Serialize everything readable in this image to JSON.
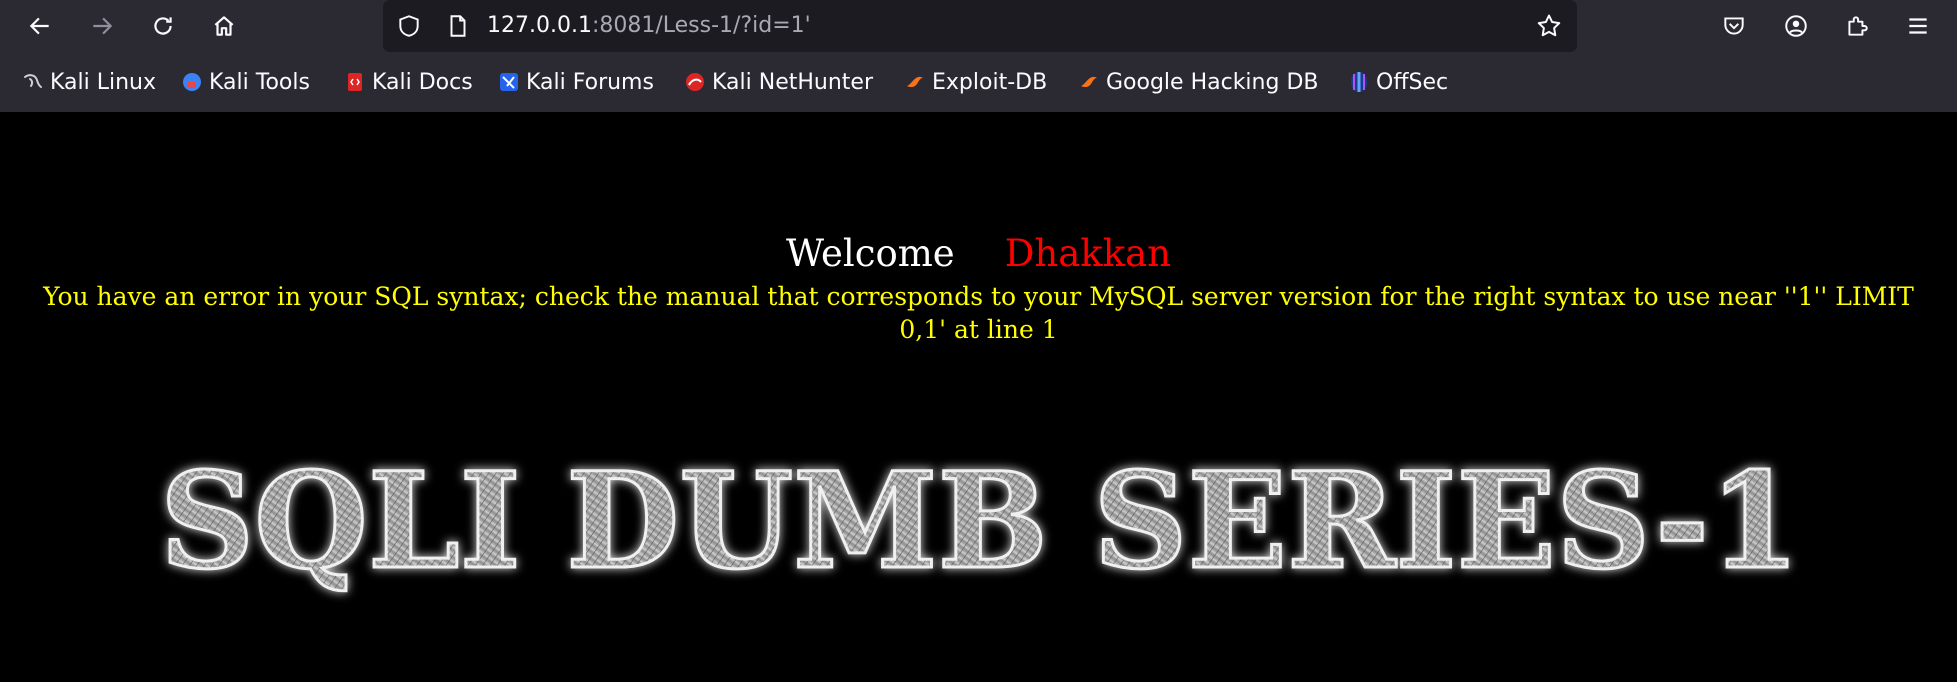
{
  "browser": {
    "url_host": "127.0.0.1",
    "url_rest": ":8081/Less-1/?id=1'",
    "bookmarks": [
      {
        "label": "Kali Linux",
        "icon": "kali-dragon-icon"
      },
      {
        "label": "Kali Tools",
        "icon": "kali-tools-icon"
      },
      {
        "label": "Kali Docs",
        "icon": "kali-docs-icon"
      },
      {
        "label": "Kali Forums",
        "icon": "kali-forums-icon"
      },
      {
        "label": "Kali NetHunter",
        "icon": "kali-nethunter-icon"
      },
      {
        "label": "Exploit-DB",
        "icon": "exploit-db-icon"
      },
      {
        "label": "Google Hacking DB",
        "icon": "google-hacking-db-icon"
      },
      {
        "label": "OffSec",
        "icon": "offsec-icon"
      }
    ]
  },
  "page": {
    "welcome_label": "Welcome",
    "welcome_name": "Dhakkan",
    "sql_error": "You have an error in your SQL syntax; check the manual that corresponds to your MySQL server version for the right syntax to use near ''1'' LIMIT 0,1' at line 1",
    "banner_text": "SQLI DUMB SERIES-1"
  },
  "colors": {
    "chrome": "#2b2a33",
    "urlbar": "#1c1b22",
    "welcome_name": "#ff0000",
    "sql_error": "#ffff00"
  }
}
